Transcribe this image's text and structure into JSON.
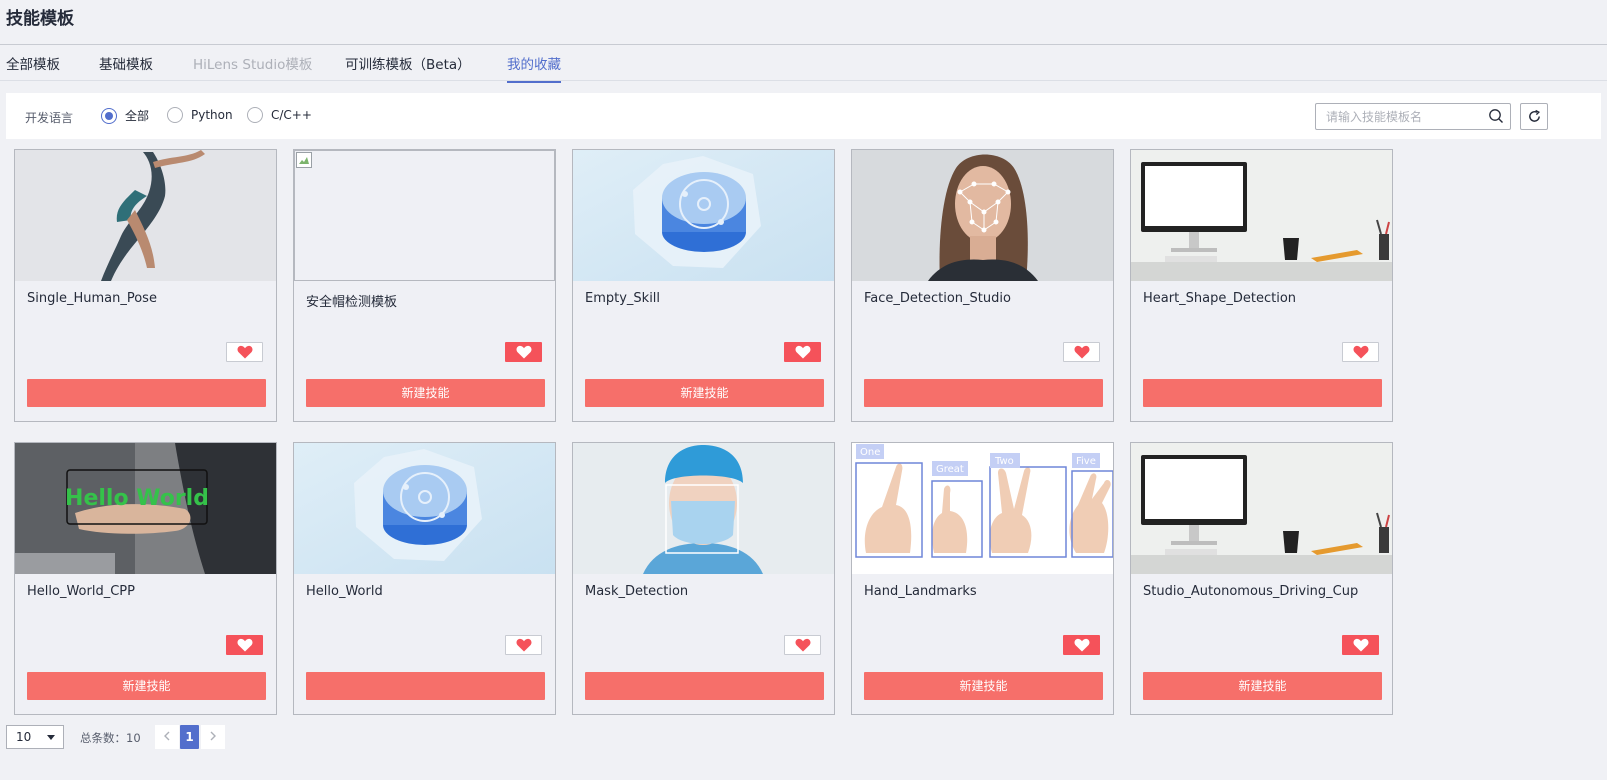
{
  "page_title": "技能模板",
  "tabs": [
    {
      "label": "全部模板"
    },
    {
      "label": "基础模板"
    },
    {
      "label": "HiLens Studio模板"
    },
    {
      "label": "可训练模板（Beta）"
    },
    {
      "label": "我的收藏"
    }
  ],
  "filter": {
    "label": "开发语言",
    "options": [
      "全部",
      "Python",
      "C/C++"
    ],
    "selected": "全部"
  },
  "search": {
    "placeholder": "请输入技能模板名",
    "value": ""
  },
  "cards": [
    {
      "name": "Single_Human_Pose",
      "favorited": false,
      "button_label": ""
    },
    {
      "name": "安全帽检测模板",
      "favorited": true,
      "button_label": "新建技能"
    },
    {
      "name": "Empty_Skill",
      "favorited": true,
      "button_label": "新建技能"
    },
    {
      "name": "Face_Detection_Studio",
      "favorited": false,
      "button_label": ""
    },
    {
      "name": "Heart_Shape_Detection",
      "favorited": false,
      "button_label": ""
    },
    {
      "name": "Hello_World_CPP",
      "favorited": true,
      "button_label": "新建技能",
      "thumb_text": "Hello World"
    },
    {
      "name": "Hello_World",
      "favorited": false,
      "button_label": ""
    },
    {
      "name": "Mask_Detection",
      "favorited": false,
      "button_label": ""
    },
    {
      "name": "Hand_Landmarks",
      "favorited": true,
      "button_label": "新建技能",
      "thumb_labels": [
        "One",
        "Great",
        "Two",
        "Five"
      ]
    },
    {
      "name": "Studio_Autonomous_Driving_Cup",
      "favorited": true,
      "button_label": "新建技能"
    }
  ],
  "pagination": {
    "page_size": "10",
    "total_label": "总条数：10",
    "current_page": "1"
  },
  "colors": {
    "accent": "#526ecc",
    "create_button": "#f66f6a",
    "favorite_active": "#f5525a",
    "heart": "#f5525a"
  },
  "icons": {
    "search": "search-icon",
    "refresh": "refresh-icon",
    "heart": "heart-icon",
    "prev": "chevron-left-icon",
    "next": "chevron-right-icon",
    "dropdown": "caret-down-icon"
  }
}
